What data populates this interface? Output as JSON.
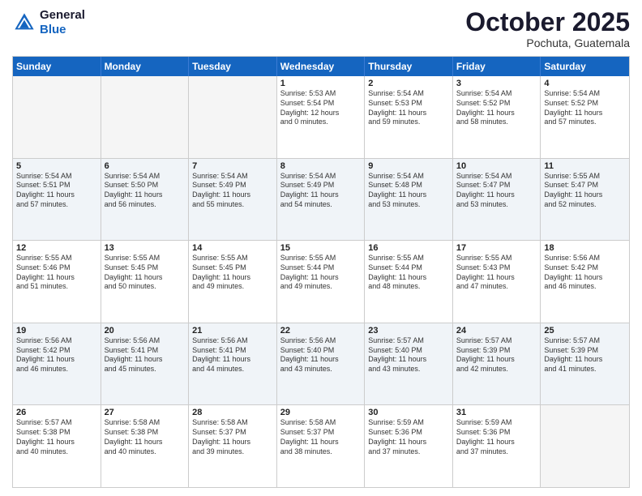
{
  "header": {
    "logo_line1": "General",
    "logo_line2": "Blue",
    "month": "October 2025",
    "location": "Pochuta, Guatemala"
  },
  "days_of_week": [
    "Sunday",
    "Monday",
    "Tuesday",
    "Wednesday",
    "Thursday",
    "Friday",
    "Saturday"
  ],
  "rows": [
    {
      "alt": false,
      "cells": [
        {
          "empty": true,
          "day": "",
          "lines": []
        },
        {
          "empty": true,
          "day": "",
          "lines": []
        },
        {
          "empty": true,
          "day": "",
          "lines": []
        },
        {
          "empty": false,
          "day": "1",
          "lines": [
            "Sunrise: 5:53 AM",
            "Sunset: 5:54 PM",
            "Daylight: 12 hours",
            "and 0 minutes."
          ]
        },
        {
          "empty": false,
          "day": "2",
          "lines": [
            "Sunrise: 5:54 AM",
            "Sunset: 5:53 PM",
            "Daylight: 11 hours",
            "and 59 minutes."
          ]
        },
        {
          "empty": false,
          "day": "3",
          "lines": [
            "Sunrise: 5:54 AM",
            "Sunset: 5:52 PM",
            "Daylight: 11 hours",
            "and 58 minutes."
          ]
        },
        {
          "empty": false,
          "day": "4",
          "lines": [
            "Sunrise: 5:54 AM",
            "Sunset: 5:52 PM",
            "Daylight: 11 hours",
            "and 57 minutes."
          ]
        }
      ]
    },
    {
      "alt": true,
      "cells": [
        {
          "empty": false,
          "day": "5",
          "lines": [
            "Sunrise: 5:54 AM",
            "Sunset: 5:51 PM",
            "Daylight: 11 hours",
            "and 57 minutes."
          ]
        },
        {
          "empty": false,
          "day": "6",
          "lines": [
            "Sunrise: 5:54 AM",
            "Sunset: 5:50 PM",
            "Daylight: 11 hours",
            "and 56 minutes."
          ]
        },
        {
          "empty": false,
          "day": "7",
          "lines": [
            "Sunrise: 5:54 AM",
            "Sunset: 5:49 PM",
            "Daylight: 11 hours",
            "and 55 minutes."
          ]
        },
        {
          "empty": false,
          "day": "8",
          "lines": [
            "Sunrise: 5:54 AM",
            "Sunset: 5:49 PM",
            "Daylight: 11 hours",
            "and 54 minutes."
          ]
        },
        {
          "empty": false,
          "day": "9",
          "lines": [
            "Sunrise: 5:54 AM",
            "Sunset: 5:48 PM",
            "Daylight: 11 hours",
            "and 53 minutes."
          ]
        },
        {
          "empty": false,
          "day": "10",
          "lines": [
            "Sunrise: 5:54 AM",
            "Sunset: 5:47 PM",
            "Daylight: 11 hours",
            "and 53 minutes."
          ]
        },
        {
          "empty": false,
          "day": "11",
          "lines": [
            "Sunrise: 5:55 AM",
            "Sunset: 5:47 PM",
            "Daylight: 11 hours",
            "and 52 minutes."
          ]
        }
      ]
    },
    {
      "alt": false,
      "cells": [
        {
          "empty": false,
          "day": "12",
          "lines": [
            "Sunrise: 5:55 AM",
            "Sunset: 5:46 PM",
            "Daylight: 11 hours",
            "and 51 minutes."
          ]
        },
        {
          "empty": false,
          "day": "13",
          "lines": [
            "Sunrise: 5:55 AM",
            "Sunset: 5:45 PM",
            "Daylight: 11 hours",
            "and 50 minutes."
          ]
        },
        {
          "empty": false,
          "day": "14",
          "lines": [
            "Sunrise: 5:55 AM",
            "Sunset: 5:45 PM",
            "Daylight: 11 hours",
            "and 49 minutes."
          ]
        },
        {
          "empty": false,
          "day": "15",
          "lines": [
            "Sunrise: 5:55 AM",
            "Sunset: 5:44 PM",
            "Daylight: 11 hours",
            "and 49 minutes."
          ]
        },
        {
          "empty": false,
          "day": "16",
          "lines": [
            "Sunrise: 5:55 AM",
            "Sunset: 5:44 PM",
            "Daylight: 11 hours",
            "and 48 minutes."
          ]
        },
        {
          "empty": false,
          "day": "17",
          "lines": [
            "Sunrise: 5:55 AM",
            "Sunset: 5:43 PM",
            "Daylight: 11 hours",
            "and 47 minutes."
          ]
        },
        {
          "empty": false,
          "day": "18",
          "lines": [
            "Sunrise: 5:56 AM",
            "Sunset: 5:42 PM",
            "Daylight: 11 hours",
            "and 46 minutes."
          ]
        }
      ]
    },
    {
      "alt": true,
      "cells": [
        {
          "empty": false,
          "day": "19",
          "lines": [
            "Sunrise: 5:56 AM",
            "Sunset: 5:42 PM",
            "Daylight: 11 hours",
            "and 46 minutes."
          ]
        },
        {
          "empty": false,
          "day": "20",
          "lines": [
            "Sunrise: 5:56 AM",
            "Sunset: 5:41 PM",
            "Daylight: 11 hours",
            "and 45 minutes."
          ]
        },
        {
          "empty": false,
          "day": "21",
          "lines": [
            "Sunrise: 5:56 AM",
            "Sunset: 5:41 PM",
            "Daylight: 11 hours",
            "and 44 minutes."
          ]
        },
        {
          "empty": false,
          "day": "22",
          "lines": [
            "Sunrise: 5:56 AM",
            "Sunset: 5:40 PM",
            "Daylight: 11 hours",
            "and 43 minutes."
          ]
        },
        {
          "empty": false,
          "day": "23",
          "lines": [
            "Sunrise: 5:57 AM",
            "Sunset: 5:40 PM",
            "Daylight: 11 hours",
            "and 43 minutes."
          ]
        },
        {
          "empty": false,
          "day": "24",
          "lines": [
            "Sunrise: 5:57 AM",
            "Sunset: 5:39 PM",
            "Daylight: 11 hours",
            "and 42 minutes."
          ]
        },
        {
          "empty": false,
          "day": "25",
          "lines": [
            "Sunrise: 5:57 AM",
            "Sunset: 5:39 PM",
            "Daylight: 11 hours",
            "and 41 minutes."
          ]
        }
      ]
    },
    {
      "alt": false,
      "cells": [
        {
          "empty": false,
          "day": "26",
          "lines": [
            "Sunrise: 5:57 AM",
            "Sunset: 5:38 PM",
            "Daylight: 11 hours",
            "and 40 minutes."
          ]
        },
        {
          "empty": false,
          "day": "27",
          "lines": [
            "Sunrise: 5:58 AM",
            "Sunset: 5:38 PM",
            "Daylight: 11 hours",
            "and 40 minutes."
          ]
        },
        {
          "empty": false,
          "day": "28",
          "lines": [
            "Sunrise: 5:58 AM",
            "Sunset: 5:37 PM",
            "Daylight: 11 hours",
            "and 39 minutes."
          ]
        },
        {
          "empty": false,
          "day": "29",
          "lines": [
            "Sunrise: 5:58 AM",
            "Sunset: 5:37 PM",
            "Daylight: 11 hours",
            "and 38 minutes."
          ]
        },
        {
          "empty": false,
          "day": "30",
          "lines": [
            "Sunrise: 5:59 AM",
            "Sunset: 5:36 PM",
            "Daylight: 11 hours",
            "and 37 minutes."
          ]
        },
        {
          "empty": false,
          "day": "31",
          "lines": [
            "Sunrise: 5:59 AM",
            "Sunset: 5:36 PM",
            "Daylight: 11 hours",
            "and 37 minutes."
          ]
        },
        {
          "empty": true,
          "day": "",
          "lines": []
        }
      ]
    }
  ]
}
